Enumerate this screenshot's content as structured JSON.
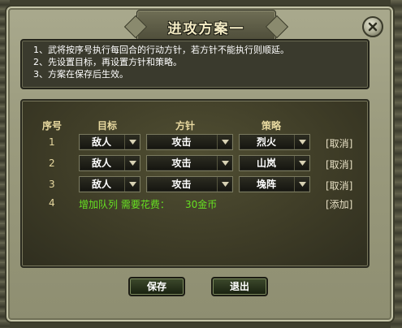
{
  "dialog": {
    "title": "进攻方案一",
    "close_icon": "close-x-icon"
  },
  "instructions": [
    "1、武将按序号执行每回合的行动方针，若方针不能执行则顺延。",
    "2、先设置目标，再设置方针和策略。",
    "3、方案在保存后生效。"
  ],
  "table": {
    "headers": {
      "index": "序号",
      "target": "目标",
      "policy": "方针",
      "strategy": "策略"
    },
    "rows": [
      {
        "index": "1",
        "target": "敌人",
        "policy": "攻击",
        "strategy": "烈火",
        "action": "[取消]"
      },
      {
        "index": "2",
        "target": "敌人",
        "policy": "攻击",
        "strategy": "山岚",
        "action": "[取消]"
      },
      {
        "index": "3",
        "target": "敌人",
        "policy": "攻击",
        "strategy": "堍阵",
        "action": "[取消]"
      }
    ],
    "add_row": {
      "index": "4",
      "label": "增加队列 需要花费：",
      "cost": "30金币",
      "action": "[添加]"
    }
  },
  "buttons": {
    "save": "保存",
    "exit": "退出"
  },
  "colors": {
    "accent_green": "#66e022",
    "header_gold": "#e8d9a0",
    "panel_dark": "#3d3b26"
  }
}
